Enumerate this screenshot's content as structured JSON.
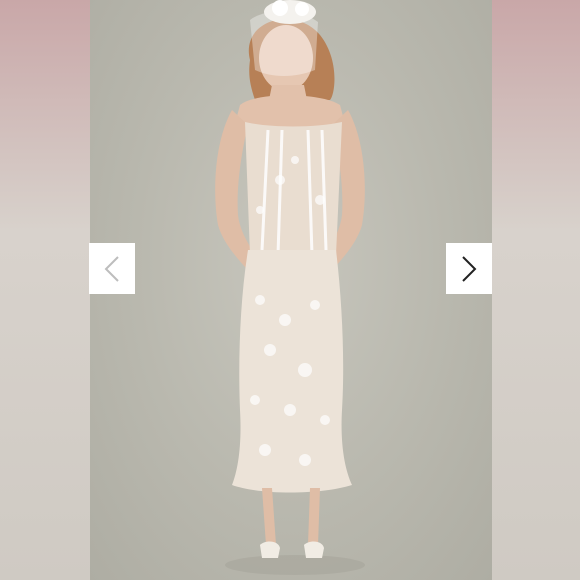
{
  "gallery": {
    "photo_description_icon": "dress-photo",
    "prev_icon": "chevron-left-icon",
    "next_icon": "chevron-right-icon",
    "prev_color": "#bdbdbd",
    "next_color": "#222222"
  }
}
